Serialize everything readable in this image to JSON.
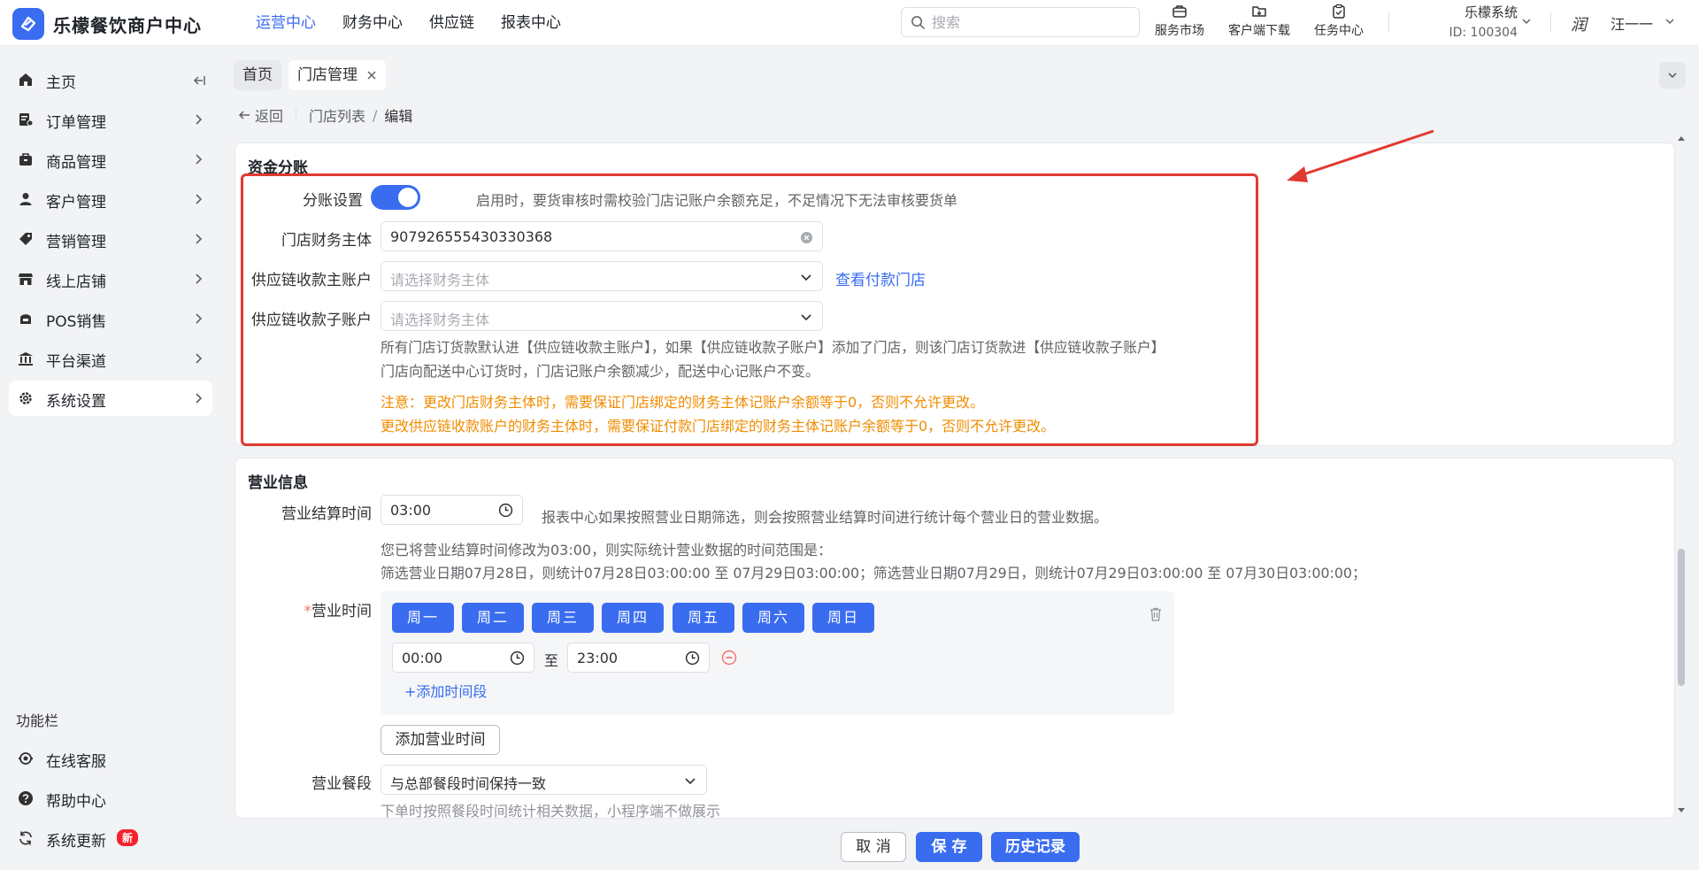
{
  "brand": {
    "name": "乐檬餐饮商户中心",
    "accent": "#3a6cf0"
  },
  "topnav": [
    "运营中心",
    "财务中心",
    "供应链",
    "报表中心"
  ],
  "search": {
    "placeholder": "搜索"
  },
  "tools": {
    "market": "服务市场",
    "download": "客户端下载",
    "tasks": "任务中心"
  },
  "org": {
    "name": "乐檬系统",
    "id": "ID: 100304"
  },
  "user": {
    "avatar_text": "润",
    "name": "汪一一"
  },
  "sidebar": {
    "items": [
      {
        "label": "主页",
        "icon": "home-icon"
      },
      {
        "label": "订单管理",
        "icon": "order-icon"
      },
      {
        "label": "商品管理",
        "icon": "goods-icon"
      },
      {
        "label": "客户管理",
        "icon": "customer-icon"
      },
      {
        "label": "营销管理",
        "icon": "tag-icon"
      },
      {
        "label": "线上店铺",
        "icon": "shop-icon"
      },
      {
        "label": "POS销售",
        "icon": "pos-icon"
      },
      {
        "label": "平台渠道",
        "icon": "bank-icon"
      },
      {
        "label": "系统设置",
        "icon": "gear-icon"
      }
    ],
    "func_title": "功能栏",
    "func_items": [
      {
        "label": "在线客服",
        "icon": "service-icon"
      },
      {
        "label": "帮助中心",
        "icon": "help-icon"
      },
      {
        "label": "系统更新",
        "icon": "refresh-icon",
        "badge": "新"
      }
    ]
  },
  "tabs": {
    "home": "首页",
    "current": "门店管理"
  },
  "breadcrumb": {
    "back": "返回",
    "list": "门店列表",
    "sep": "/",
    "current": "编辑"
  },
  "fund": {
    "title": "资金分账",
    "split_label": "分账设置",
    "split_enabled": true,
    "split_hint": "启用时，要货审核时需校验门店记账户余额充足，不足情况下无法审核要货单",
    "entity_label": "门店财务主体",
    "entity_value": "907926555430330368",
    "main_account_label": "供应链收款主账户",
    "main_account_placeholder": "请选择财务主体",
    "view_stores_link": "查看付款门店",
    "sub_account_label": "供应链收款子账户",
    "sub_account_placeholder": "请选择财务主体",
    "note1": "所有门店订货款默认进【供应链收款主账户】，如果【供应链收款子账户】添加了门店，则该门店订货款进【供应链收款子账户】",
    "note2": "门店向配送中心订货时，门店记账户余额减少，配送中心记账户不变。",
    "warn1": "注意：更改门店财务主体时，需要保证门店绑定的财务主体记账户余额等于0，否则不允许更改。",
    "warn2": "更改供应链收款账户的财务主体时，需要保证付款门店绑定的财务主体记账户余额等于0，否则不允许更改。"
  },
  "business": {
    "title": "营业信息",
    "settle_label": "营业结算时间",
    "settle_value": "03:00",
    "settle_hint": "报表中心如果按照营业日期筛选，则会按照营业结算时间进行统计每个营业日的营业数据。",
    "settle_info1": "您已将营业结算时间修改为03:00，则实际统计营业数据的时间范围是：",
    "settle_info2": "筛选营业日期07月28日，则统计07月28日03:00:00 至 07月29日03:00:00；筛选营业日期07月29日，则统计07月29日03:00:00 至 07月30日03:00:00；",
    "hours_required_mark": "*",
    "hours_label": "营业时间",
    "days": [
      "周一",
      "周二",
      "周三",
      "周四",
      "周五",
      "周六",
      "周日"
    ],
    "start_time": "00:00",
    "to": "至",
    "end_time": "23:00",
    "add_period": "+添加时间段",
    "add_hours_button": "添加营业时间",
    "meal_label": "营业餐段",
    "meal_value": "与总部餐段时间保持一致",
    "meal_hint": "下单时按照餐段时间统计相关数据，小程序端不做展示"
  },
  "footer": {
    "cancel": "取 消",
    "save": "保 存",
    "history": "历史记录"
  }
}
